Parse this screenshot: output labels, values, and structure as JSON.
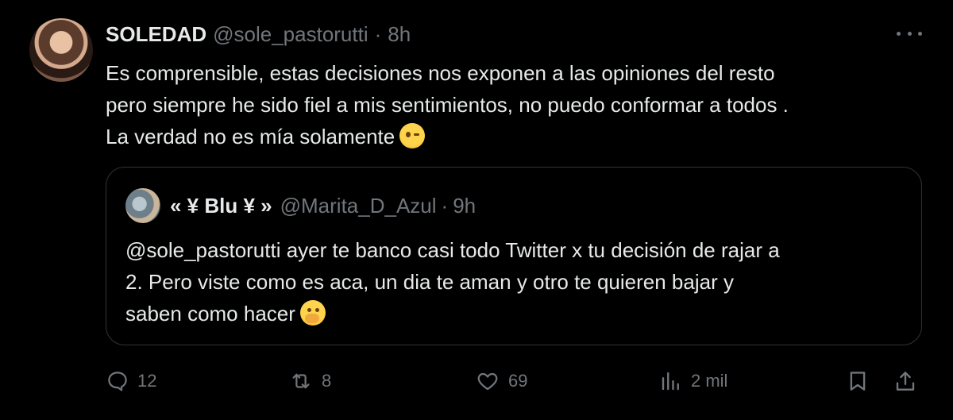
{
  "tweet": {
    "author_name": "SOLEDAD",
    "author_handle": "@sole_pastorutti",
    "separator": "·",
    "time": "8h",
    "text_lines": [
      "Es comprensible,  estas decisiones nos exponen a las opiniones del resto",
      "pero siempre he sido fiel a mis sentimientos, no puedo conformar a todos .",
      "La verdad no es mía solamente"
    ],
    "emoji": "winking-face-emoji"
  },
  "quoted_tweet": {
    "author_name": "« ¥ Blu ¥ »",
    "author_handle": "@Marita_D_Azul",
    "separator": "·",
    "time": "9h",
    "text_lines": [
      "@sole_pastorutti ayer te banco casi todo Twitter x tu decisión de rajar a",
      "2. Pero viste como es aca, un dia te aman y otro te quieren bajar y",
      "saben como hacer"
    ],
    "emoji": "hand-over-mouth-emoji"
  },
  "actions": {
    "replies": "12",
    "retweets": "8",
    "likes": "69",
    "views": "2 mil"
  },
  "icons": [
    "more-icon",
    "reply-icon",
    "retweet-icon",
    "like-icon",
    "views-icon",
    "bookmark-icon",
    "share-icon"
  ],
  "colors": {
    "background": "#000000",
    "text": "#e7e9ea",
    "secondary": "#71767b",
    "border": "#2f3336"
  }
}
